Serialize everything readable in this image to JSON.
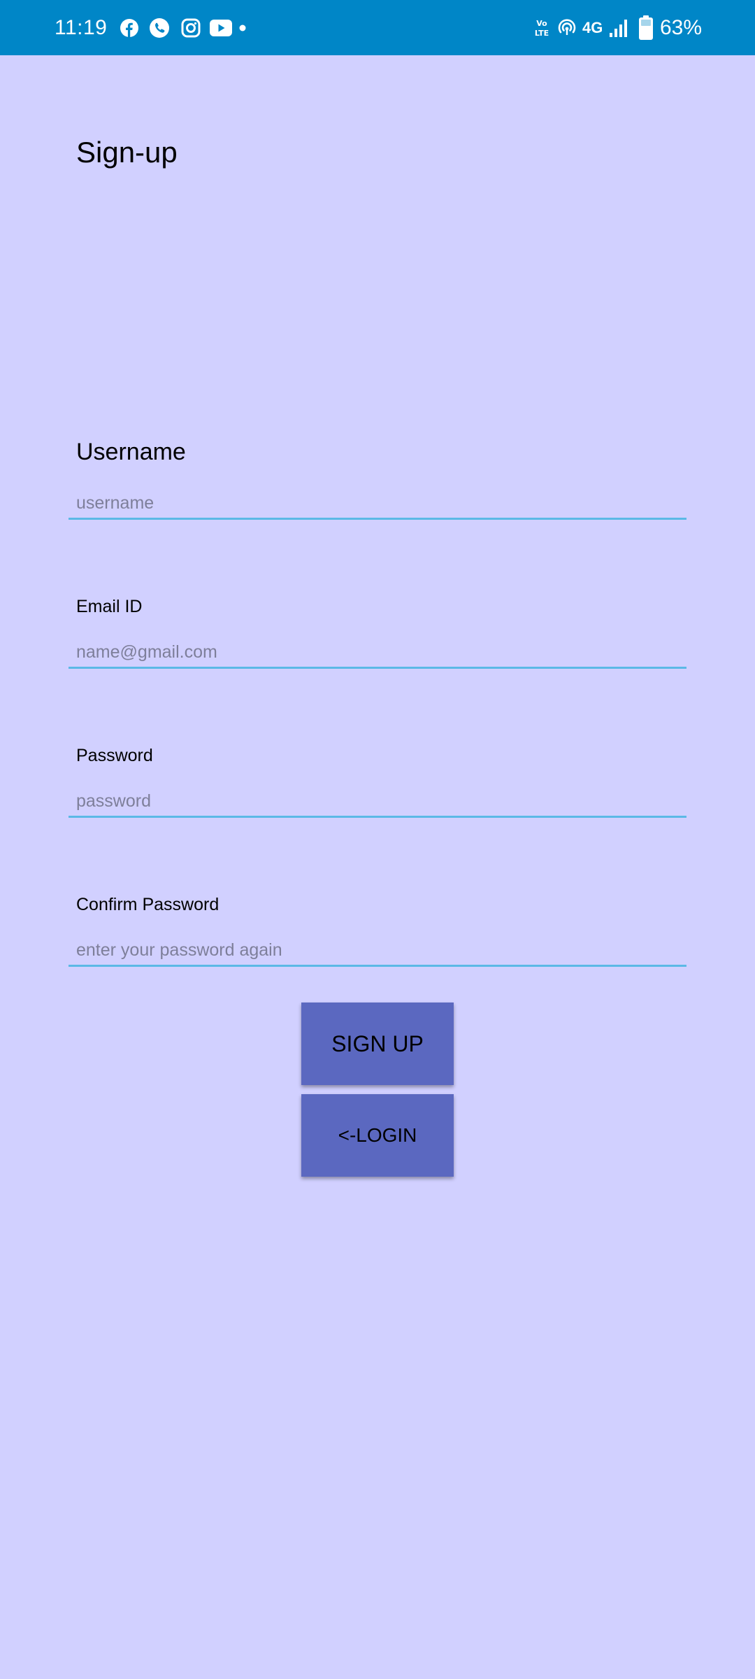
{
  "status_bar": {
    "time": "11:19",
    "network": "4G",
    "battery": "63%",
    "notification_icons": [
      "facebook-icon",
      "phone-icon",
      "instagram-icon",
      "youtube-icon",
      "dot-icon"
    ],
    "system_icons": [
      "volte-icon",
      "hotspot-icon",
      "signal-icon",
      "battery-icon"
    ],
    "color": "#0086c7"
  },
  "page": {
    "title": "Sign-up",
    "background": "#d1d0ff"
  },
  "form": {
    "username": {
      "label": "Username",
      "placeholder": "username",
      "value": ""
    },
    "email": {
      "label": "Email ID",
      "placeholder": "name@gmail.com",
      "value": ""
    },
    "password": {
      "label": "Password",
      "placeholder": "password",
      "value": ""
    },
    "confirm_password": {
      "label": "Confirm Password",
      "placeholder": "enter your password again",
      "value": ""
    },
    "underline_color": "#5bb9e6"
  },
  "buttons": {
    "signup_label": "SIGN UP",
    "login_label": "<-LOGIN",
    "color": "#5b68c0"
  }
}
